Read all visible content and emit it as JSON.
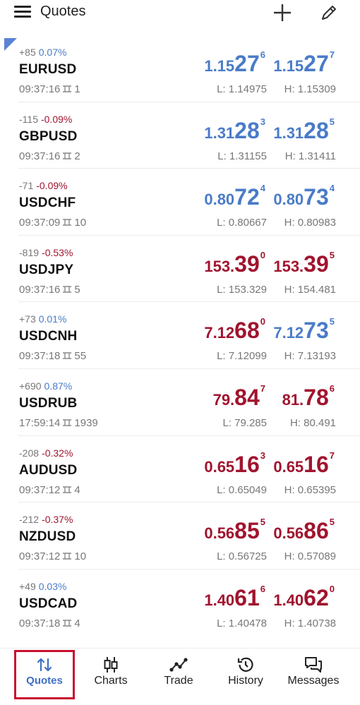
{
  "header": {
    "title": "Quotes",
    "menu_icon": "hamburger-menu-icon",
    "add_icon": "plus-icon",
    "edit_icon": "pencil-icon"
  },
  "quotes": [
    {
      "symbol": "EURUSD",
      "change_points": "+85",
      "change_pct": "0.07%",
      "direction": "up",
      "time": "09:37:16",
      "spread": "1",
      "bid": {
        "small": "1.15",
        "big": "27",
        "pip": "6",
        "color": "up"
      },
      "ask": {
        "small": "1.15",
        "big": "27",
        "pip": "7",
        "color": "up"
      },
      "low": "L: 1.14975",
      "high": "H: 1.15309"
    },
    {
      "symbol": "GBPUSD",
      "change_points": "-115",
      "change_pct": "-0.09%",
      "direction": "down",
      "time": "09:37:16",
      "spread": "2",
      "bid": {
        "small": "1.31",
        "big": "28",
        "pip": "3",
        "color": "up"
      },
      "ask": {
        "small": "1.31",
        "big": "28",
        "pip": "5",
        "color": "up"
      },
      "low": "L: 1.31155",
      "high": "H: 1.31411"
    },
    {
      "symbol": "USDCHF",
      "change_points": "-71",
      "change_pct": "-0.09%",
      "direction": "down",
      "time": "09:37:09",
      "spread": "10",
      "bid": {
        "small": "0.80",
        "big": "72",
        "pip": "4",
        "color": "up"
      },
      "ask": {
        "small": "0.80",
        "big": "73",
        "pip": "4",
        "color": "up"
      },
      "low": "L: 0.80667",
      "high": "H: 0.80983"
    },
    {
      "symbol": "USDJPY",
      "change_points": "-819",
      "change_pct": "-0.53%",
      "direction": "down",
      "time": "09:37:16",
      "spread": "5",
      "bid": {
        "small": "153.",
        "big": "39",
        "pip": "0",
        "color": "down"
      },
      "ask": {
        "small": "153.",
        "big": "39",
        "pip": "5",
        "color": "down"
      },
      "low": "L: 153.329",
      "high": "H: 154.481"
    },
    {
      "symbol": "USDCNH",
      "change_points": "+73",
      "change_pct": "0.01%",
      "direction": "up",
      "time": "09:37:18",
      "spread": "55",
      "bid": {
        "small": "7.12",
        "big": "68",
        "pip": "0",
        "color": "down"
      },
      "ask": {
        "small": "7.12",
        "big": "73",
        "pip": "5",
        "color": "up"
      },
      "low": "L: 7.12099",
      "high": "H: 7.13193"
    },
    {
      "symbol": "USDRUB",
      "change_points": "+690",
      "change_pct": "0.87%",
      "direction": "up",
      "time": "17:59:14",
      "spread": "1939",
      "bid": {
        "small": "79.",
        "big": "84",
        "pip": "7",
        "color": "down"
      },
      "ask": {
        "small": "81.",
        "big": "78",
        "pip": "6",
        "color": "down"
      },
      "low": "L: 79.285",
      "high": "H: 80.491"
    },
    {
      "symbol": "AUDUSD",
      "change_points": "-208",
      "change_pct": "-0.32%",
      "direction": "down",
      "time": "09:37:12",
      "spread": "4",
      "bid": {
        "small": "0.65",
        "big": "16",
        "pip": "3",
        "color": "down"
      },
      "ask": {
        "small": "0.65",
        "big": "16",
        "pip": "7",
        "color": "down"
      },
      "low": "L: 0.65049",
      "high": "H: 0.65395"
    },
    {
      "symbol": "NZDUSD",
      "change_points": "-212",
      "change_pct": "-0.37%",
      "direction": "down",
      "time": "09:37:12",
      "spread": "10",
      "bid": {
        "small": "0.56",
        "big": "85",
        "pip": "5",
        "color": "down"
      },
      "ask": {
        "small": "0.56",
        "big": "86",
        "pip": "5",
        "color": "down"
      },
      "low": "L: 0.56725",
      "high": "H: 0.57089"
    },
    {
      "symbol": "USDCAD",
      "change_points": "+49",
      "change_pct": "0.03%",
      "direction": "up",
      "time": "09:37:18",
      "spread": "4",
      "bid": {
        "small": "1.40",
        "big": "61",
        "pip": "6",
        "color": "down"
      },
      "ask": {
        "small": "1.40",
        "big": "62",
        "pip": "0",
        "color": "down"
      },
      "low": "L: 1.40478",
      "high": "H: 1.40738"
    }
  ],
  "nav": [
    {
      "label": "Quotes",
      "icon": "sort-arrows-icon",
      "active": true
    },
    {
      "label": "Charts",
      "icon": "candlestick-icon",
      "active": false
    },
    {
      "label": "Trade",
      "icon": "trend-line-icon",
      "active": false
    },
    {
      "label": "History",
      "icon": "history-clock-icon",
      "active": false
    },
    {
      "label": "Messages",
      "icon": "chat-bubbles-icon",
      "active": false
    }
  ],
  "colors": {
    "up": "#4a7bc8",
    "down": "#a0142e",
    "active_nav": "#3f6fc4",
    "active_border": "#c8102e"
  }
}
